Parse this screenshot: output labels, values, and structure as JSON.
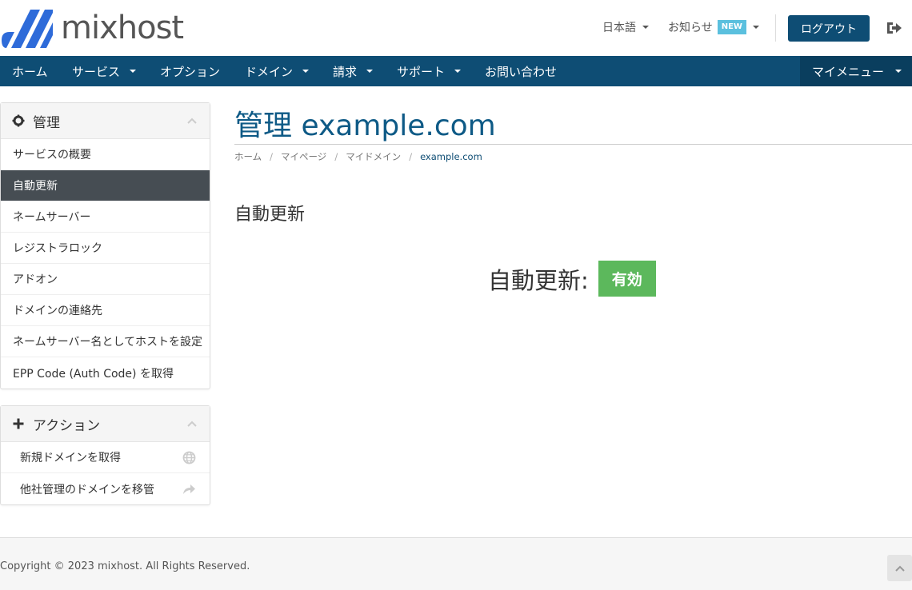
{
  "brand": {
    "name": "mixhost",
    "accent": "#0e4d74",
    "logo_blue": "#2e6bd9"
  },
  "header": {
    "language": "日本語",
    "news": "お知らせ",
    "news_badge": "NEW",
    "logout": "ログアウト",
    "logout_icon": "sign-out-icon"
  },
  "nav": {
    "items": [
      {
        "label": "ホーム",
        "dropdown": false
      },
      {
        "label": "サービス",
        "dropdown": true
      },
      {
        "label": "オプション",
        "dropdown": false
      },
      {
        "label": "ドメイン",
        "dropdown": true
      },
      {
        "label": "請求",
        "dropdown": true
      },
      {
        "label": "サポート",
        "dropdown": true
      },
      {
        "label": "お問い合わせ",
        "dropdown": false
      }
    ],
    "my_menu": "マイメニュー"
  },
  "sidebar": {
    "manage": {
      "title": "管理",
      "icon": "gear-icon",
      "items": [
        {
          "label": "サービスの概要",
          "active": false
        },
        {
          "label": "自動更新",
          "active": true
        },
        {
          "label": "ネームサーバー",
          "active": false
        },
        {
          "label": "レジストラロック",
          "active": false
        },
        {
          "label": "アドオン",
          "active": false
        },
        {
          "label": "ドメインの連絡先",
          "active": false
        },
        {
          "label": "ネームサーバー名としてホストを設定",
          "active": false
        },
        {
          "label": "EPP Code (Auth Code) を取得",
          "active": false
        }
      ]
    },
    "actions": {
      "title": "アクション",
      "icon": "plus-icon",
      "items": [
        {
          "label": "新規ドメインを取得",
          "icon": "globe-icon"
        },
        {
          "label": "他社管理のドメインを移管",
          "icon": "share-arrow-icon"
        }
      ]
    }
  },
  "main": {
    "title": "管理 example.com",
    "breadcrumb": [
      "ホーム",
      "マイページ",
      "マイドメイン",
      "example.com"
    ],
    "section_title": "自動更新",
    "status_label": "自動更新:",
    "status_value": "有効",
    "status_color": "#5cb85c"
  },
  "footer": {
    "copyright": "Copyright © 2023 mixhost. All Rights Reserved."
  }
}
